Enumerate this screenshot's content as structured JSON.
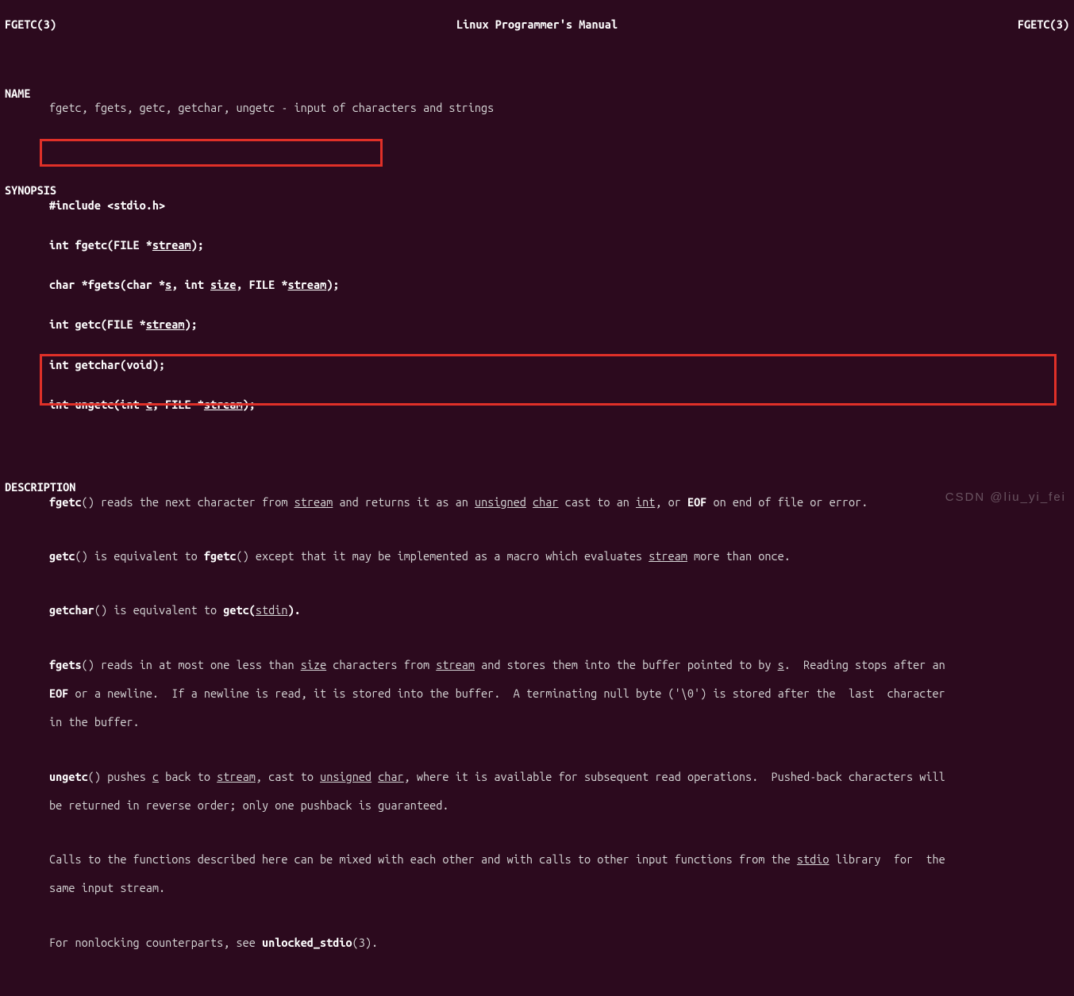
{
  "header": {
    "left": "FGETC(3)",
    "center": "Linux Programmer's Manual",
    "right": "FGETC(3)"
  },
  "sections": {
    "name_label": "NAME",
    "name_text": "fgetc, fgets, getc, getchar, ungetc - input of characters and strings",
    "synopsis_label": "SYNOPSIS",
    "include_line": "#include <stdio.h>",
    "fn_fgetc_pre": "int fgetc(FILE *",
    "fn_fgetc_stream": "stream",
    "fn_fgetc_post": ");",
    "fn_fgets_pre": "char *fgets(char *",
    "fn_fgets_s": "s",
    "fn_fgets_mid1": ", int ",
    "fn_fgets_size": "size",
    "fn_fgets_mid2": ", FILE *",
    "fn_fgets_stream": "stream",
    "fn_fgets_post": ");",
    "fn_getc_pre": "int getc(FILE *",
    "fn_getc_stream": "stream",
    "fn_getc_post": ");",
    "fn_getchar": "int getchar(void);",
    "fn_ungetc_pre": "int ungetc(int ",
    "fn_ungetc_c": "c",
    "fn_ungetc_mid": ", FILE *",
    "fn_ungetc_stream": "stream",
    "fn_ungetc_post": ");",
    "description_label": "DESCRIPTION",
    "d_fgetc_name": "fgetc",
    "d_fgetc_t1": "() reads the next character from ",
    "d_fgetc_stream": "stream",
    "d_fgetc_t2": " and returns it as an ",
    "d_fgetc_unsigned": "unsigned",
    "d_fgetc_sp1": " ",
    "d_fgetc_char": "char",
    "d_fgetc_t3": " cast to an ",
    "d_fgetc_int": "int",
    "d_fgetc_t4": ", or ",
    "d_fgetc_eof": "EOF",
    "d_fgetc_t5": " on end of file or error.",
    "d_getc_name": "getc",
    "d_getc_t1": "() is equivalent to ",
    "d_getc_fgetc": "fgetc",
    "d_getc_t2": "() except that it may be implemented as a macro which evaluates ",
    "d_getc_stream": "stream",
    "d_getc_t3": " more than once.",
    "d_getchar_name": "getchar",
    "d_getchar_t1": "() is equivalent to ",
    "d_getchar_getc": "getc(",
    "d_getchar_stdin": "stdin",
    "d_getchar_t2": ").",
    "d_fgets_name": "fgets",
    "d_fgets_t1": "() reads in at most one less than ",
    "d_fgets_size": "size",
    "d_fgets_t2": " characters from ",
    "d_fgets_stream": "stream",
    "d_fgets_t3": " and stores them into the buffer pointed to by ",
    "d_fgets_s": "s",
    "d_fgets_t4": ".  Reading stops after an",
    "d_fgets_line2_eof": "EOF",
    "d_fgets_line2_t": " or a newline.  If a newline is read, it is stored into the buffer.  A terminating null byte ('\\0') is stored after the  last  character",
    "d_fgets_line3": "in the buffer.",
    "d_ungetc_name": "ungetc",
    "d_ungetc_t1": "() pushes ",
    "d_ungetc_c": "c",
    "d_ungetc_t2": " back to ",
    "d_ungetc_stream": "stream",
    "d_ungetc_t3": ", cast to ",
    "d_ungetc_unsigned": "unsigned",
    "d_ungetc_sp": " ",
    "d_ungetc_char": "char",
    "d_ungetc_t4": ", where it is available for subsequent read operations.  Pushed-back characters will",
    "d_ungetc_line2": "be returned in reverse order; only one pushback is guaranteed.",
    "d_calls_t1": "Calls to the functions described here can be mixed with each other and with calls to other input functions from the ",
    "d_calls_stdio": "stdio",
    "d_calls_t2": " library  for  the",
    "d_calls_line2": "same input stream.",
    "d_nonblock_t1": "For nonlocking counterparts, see ",
    "d_nonblock_bold": "unlocked_stdio",
    "d_nonblock_t2": "(3)."
  },
  "watermark": "CSDN @liu_yi_fei"
}
